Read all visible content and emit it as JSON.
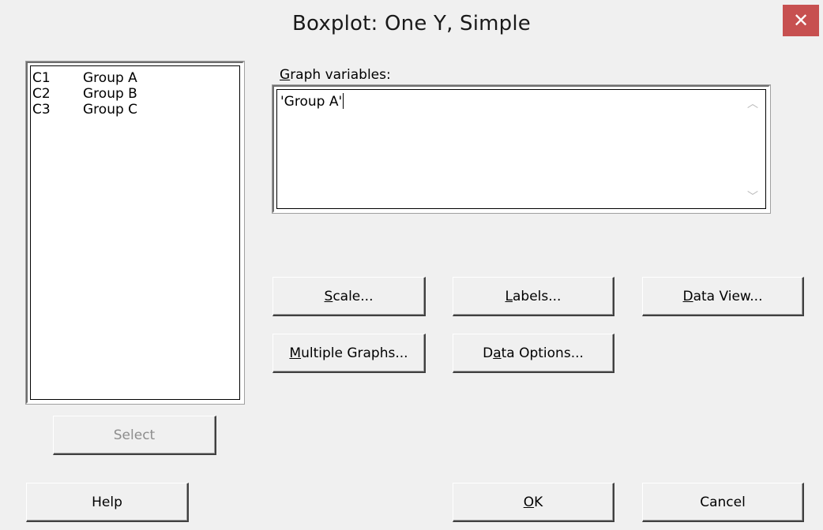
{
  "window": {
    "title": "Boxplot: One Y, Simple",
    "close_symbol": "✕"
  },
  "variables": [
    {
      "col": "C1",
      "name": "Group A"
    },
    {
      "col": "C2",
      "name": "Group B"
    },
    {
      "col": "C3",
      "name": "Group C"
    }
  ],
  "graph_variables": {
    "label_accel": "G",
    "label_rest": "raph variables:",
    "value": "'Group A'"
  },
  "buttons": {
    "scale": {
      "accel": "S",
      "rest": "cale..."
    },
    "labels": {
      "accel": "L",
      "rest": "abels..."
    },
    "data_view": {
      "accel": "D",
      "rest": "ata View..."
    },
    "multiple_graphs": {
      "accel": "M",
      "rest": "ultiple Graphs..."
    },
    "data_options": {
      "pre": "D",
      "accel": "a",
      "rest": "ta Options..."
    },
    "select": "Select",
    "help": "Help",
    "ok": {
      "accel": "O",
      "rest": "K"
    },
    "cancel": "Cancel"
  }
}
